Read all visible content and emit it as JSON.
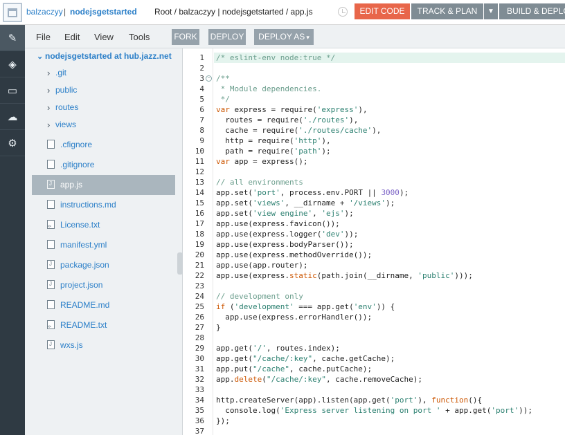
{
  "header": {
    "user": "balzaczyy",
    "separator": "|",
    "project": "nodejsgetstarted",
    "breadcrumb": "Root / balzaczyy | nodejsgetstarted / app.js",
    "edit_code": "EDIT CODE",
    "track_plan": "TRACK & PLAN",
    "track_caret": "▼",
    "build_deploy": "BUILD & DEPLOY"
  },
  "rail": {
    "items": [
      {
        "icon": "pencil-icon",
        "glyph": "✎"
      },
      {
        "icon": "git-icon",
        "glyph": "◈"
      },
      {
        "icon": "terminal-icon",
        "glyph": "▭"
      },
      {
        "icon": "cloud-icon",
        "glyph": "☁"
      },
      {
        "icon": "gear-icon",
        "glyph": "⚙"
      }
    ]
  },
  "menubar": {
    "file": "File",
    "edit": "Edit",
    "view": "View",
    "tools": "Tools",
    "fork": "FORK",
    "deploy": "DEPLOY",
    "deploy_as": "DEPLOY AS",
    "deploy_as_caret": "▾"
  },
  "navigator": {
    "root_chevron": "⌄",
    "root": "nodejsgetstarted at hub.jazz.net",
    "folders": [
      ".git",
      "public",
      "routes",
      "views"
    ],
    "folder_chevron": "›",
    "files": [
      {
        "name": ".cfignore",
        "type": "text"
      },
      {
        "name": ".gitignore",
        "type": "text"
      },
      {
        "name": "app.js",
        "type": "js",
        "selected": true
      },
      {
        "name": "instructions.md",
        "type": "text"
      },
      {
        "name": "License.txt",
        "type": "code"
      },
      {
        "name": "manifest.yml",
        "type": "text"
      },
      {
        "name": "package.json",
        "type": "js"
      },
      {
        "name": "project.json",
        "type": "js"
      },
      {
        "name": "README.md",
        "type": "text"
      },
      {
        "name": "README.txt",
        "type": "code"
      },
      {
        "name": "wxs.js",
        "type": "js"
      }
    ]
  },
  "editor": {
    "fold_glyph": "−",
    "lines": [
      [
        {
          "t": "/* eslint-env node:true */",
          "c": "c"
        }
      ],
      [],
      [
        {
          "t": "/**",
          "c": "c"
        }
      ],
      [
        {
          "t": " * Module dependencies.",
          "c": "c"
        }
      ],
      [
        {
          "t": " */",
          "c": "c"
        }
      ],
      [
        {
          "t": "var",
          "c": "k"
        },
        {
          "t": " express = require("
        },
        {
          "t": "'express'",
          "c": "s"
        },
        {
          "t": "),"
        }
      ],
      [
        {
          "t": "  routes = require("
        },
        {
          "t": "'./routes'",
          "c": "s"
        },
        {
          "t": "),"
        }
      ],
      [
        {
          "t": "  cache = require("
        },
        {
          "t": "'./routes/cache'",
          "c": "s"
        },
        {
          "t": "),"
        }
      ],
      [
        {
          "t": "  http = require("
        },
        {
          "t": "'http'",
          "c": "s"
        },
        {
          "t": "),"
        }
      ],
      [
        {
          "t": "  path = require("
        },
        {
          "t": "'path'",
          "c": "s"
        },
        {
          "t": ");"
        }
      ],
      [
        {
          "t": "var",
          "c": "k"
        },
        {
          "t": " app = express();"
        }
      ],
      [],
      [
        {
          "t": "// all environments",
          "c": "c"
        }
      ],
      [
        {
          "t": "app.set("
        },
        {
          "t": "'port'",
          "c": "s"
        },
        {
          "t": ", process.env.PORT || "
        },
        {
          "t": "3000",
          "c": "n"
        },
        {
          "t": ");"
        }
      ],
      [
        {
          "t": "app.set("
        },
        {
          "t": "'views'",
          "c": "s"
        },
        {
          "t": ", __dirname + "
        },
        {
          "t": "'/views'",
          "c": "s"
        },
        {
          "t": ");"
        }
      ],
      [
        {
          "t": "app.set("
        },
        {
          "t": "'view engine'",
          "c": "s"
        },
        {
          "t": ", "
        },
        {
          "t": "'ejs'",
          "c": "s"
        },
        {
          "t": ");"
        }
      ],
      [
        {
          "t": "app.use(express.favicon());"
        }
      ],
      [
        {
          "t": "app.use(express.logger("
        },
        {
          "t": "'dev'",
          "c": "s"
        },
        {
          "t": "));"
        }
      ],
      [
        {
          "t": "app.use(express.bodyParser());"
        }
      ],
      [
        {
          "t": "app.use(express.methodOverride());"
        }
      ],
      [
        {
          "t": "app.use(app.router);"
        }
      ],
      [
        {
          "t": "app.use(express."
        },
        {
          "t": "static",
          "c": "k"
        },
        {
          "t": "(path.join(__dirname, "
        },
        {
          "t": "'public'",
          "c": "s"
        },
        {
          "t": ")));"
        }
      ],
      [],
      [
        {
          "t": "// development only",
          "c": "c"
        }
      ],
      [
        {
          "t": "if",
          "c": "k"
        },
        {
          "t": " ("
        },
        {
          "t": "'development'",
          "c": "s"
        },
        {
          "t": " === app.get("
        },
        {
          "t": "'env'",
          "c": "s"
        },
        {
          "t": ")) {"
        }
      ],
      [
        {
          "t": "  app.use(express.errorHandler());"
        }
      ],
      [
        {
          "t": "}"
        }
      ],
      [],
      [
        {
          "t": "app.get("
        },
        {
          "t": "'/'",
          "c": "s"
        },
        {
          "t": ", routes.index);"
        }
      ],
      [
        {
          "t": "app.get("
        },
        {
          "t": "\"/cache/:key\"",
          "c": "s"
        },
        {
          "t": ", cache.getCache);"
        }
      ],
      [
        {
          "t": "app.put("
        },
        {
          "t": "\"/cache\"",
          "c": "s"
        },
        {
          "t": ", cache.putCache);"
        }
      ],
      [
        {
          "t": "app."
        },
        {
          "t": "delete",
          "c": "k"
        },
        {
          "t": "("
        },
        {
          "t": "\"/cache/:key\"",
          "c": "s"
        },
        {
          "t": ", cache.removeCache);"
        }
      ],
      [],
      [
        {
          "t": "http.createServer(app).listen(app.get("
        },
        {
          "t": "'port'",
          "c": "s"
        },
        {
          "t": "), "
        },
        {
          "t": "function",
          "c": "k"
        },
        {
          "t": "(){"
        }
      ],
      [
        {
          "t": "  console.log("
        },
        {
          "t": "'Express server listening on port '",
          "c": "s"
        },
        {
          "t": " + app.get("
        },
        {
          "t": "'port'",
          "c": "s"
        },
        {
          "t": "));"
        }
      ],
      [
        {
          "t": "});"
        }
      ],
      []
    ]
  }
}
